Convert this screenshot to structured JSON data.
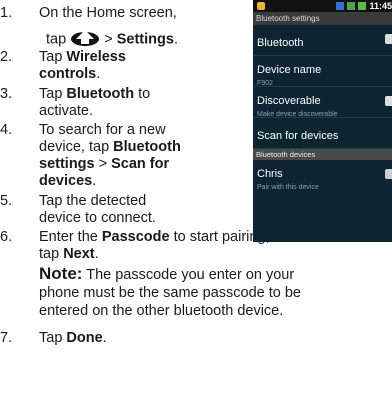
{
  "steps": [
    {
      "num": "1.",
      "line1": "On the Home screen,",
      "tap": "tap",
      "gt": ">",
      "settings": "Settings",
      "period": "."
    },
    {
      "num": "2.",
      "pre": "Tap ",
      "bold": "Wireless",
      "bold2": "controls",
      "post": "."
    },
    {
      "num": "3.",
      "pre": "Tap ",
      "bold": "Bluetooth",
      "post": " to",
      "line2": "activate."
    },
    {
      "num": "4.",
      "line1": "To search for a new",
      "line2pre": "device, tap ",
      "line2bold": "Bluetooth",
      "line3bold": "settings",
      "line3mid": " > ",
      "line3bold2": "Scan for",
      "line4bold": "devices",
      "line4post": "."
    },
    {
      "num": "5.",
      "line1": "Tap the detected",
      "line2": "device to connect."
    },
    {
      "num": "6.",
      "pre": "Enter the ",
      "bold": "Passcode",
      "post": " to start pairing, then",
      "line2pre": "tap ",
      "line2bold": "Next",
      "line2post": "."
    },
    {
      "num": "7.",
      "pre": "Tap ",
      "bold": "Done",
      "post": "."
    }
  ],
  "note": {
    "label": "Note:",
    "line1": " The passcode you enter on your",
    "line2": "phone must be the same passcode to be",
    "line3": "entered on the other bluetooth device."
  },
  "phone": {
    "time": "11:45",
    "title": "Bluetooth settings",
    "rows": [
      {
        "main": "Bluetooth",
        "sub": "",
        "checkbox": true
      },
      {
        "main": "Device name",
        "sub": "F902",
        "checkbox": false
      },
      {
        "main": "Discoverable",
        "sub": "Make device discoverable",
        "checkbox": true
      },
      {
        "main": "Scan for devices",
        "sub": "",
        "checkbox": false
      }
    ],
    "section": "Bluetooth devices",
    "device": {
      "main": "Chris",
      "sub": "Pair with this device"
    }
  },
  "icons": {
    "home": "home-arrow-icon",
    "statusbar": [
      "notification-icon",
      "bluetooth-icon",
      "signal-icon",
      "battery-icon"
    ]
  }
}
